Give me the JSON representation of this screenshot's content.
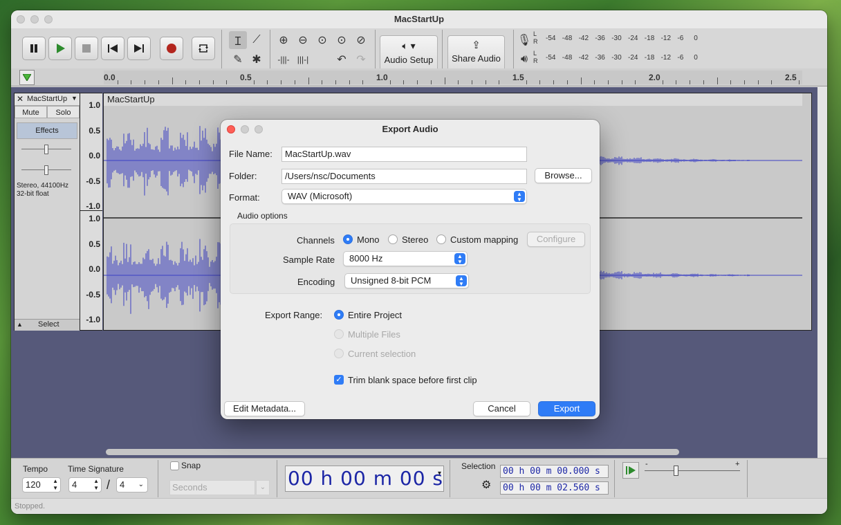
{
  "window": {
    "title": "MacStartUp"
  },
  "toolbar": {
    "audio_setup_label": "Audio Setup",
    "share_audio_label": "Share Audio",
    "meter_scale": [
      "-54",
      "-48",
      "-42",
      "-36",
      "-30",
      "-24",
      "-18",
      "-12",
      "-6",
      "0"
    ],
    "meter_channels": [
      "L",
      "R"
    ]
  },
  "ruler": {
    "ticks": [
      "0.0",
      "0.5",
      "1.0",
      "1.5",
      "2.0",
      "2.5"
    ]
  },
  "track": {
    "name": "MacStartUp",
    "clip_name": "MacStartUp",
    "mute_label": "Mute",
    "solo_label": "Solo",
    "effects_label": "Effects",
    "info_line1": "Stereo, 44100Hz",
    "info_line2": "32-bit float",
    "select_label": "Select",
    "scale_labels": [
      "1.0",
      "0.5",
      "0.0",
      "-0.5",
      "-1.0"
    ]
  },
  "dialog": {
    "title": "Export Audio",
    "file_name_label": "File Name:",
    "file_name_value": "MacStartUp.wav",
    "folder_label": "Folder:",
    "folder_value": "/Users/nsc/Documents",
    "browse_label": "Browse...",
    "format_label": "Format:",
    "format_value": "WAV (Microsoft)",
    "audio_options_label": "Audio options",
    "channels_label": "Channels",
    "channel_options": [
      "Mono",
      "Stereo",
      "Custom mapping"
    ],
    "channel_selected": "Mono",
    "configure_label": "Configure",
    "sample_rate_label": "Sample Rate",
    "sample_rate_value": "8000 Hz",
    "encoding_label": "Encoding",
    "encoding_value": "Unsigned 8-bit PCM",
    "export_range_label": "Export Range:",
    "range_options": [
      "Entire Project",
      "Multiple Files",
      "Current selection"
    ],
    "range_selected": "Entire Project",
    "trim_label": "Trim blank space before first clip",
    "trim_checked": true,
    "edit_metadata_label": "Edit Metadata...",
    "cancel_label": "Cancel",
    "export_label": "Export"
  },
  "bottom": {
    "tempo_label": "Tempo",
    "tempo_value": "120",
    "time_sig_label": "Time Signature",
    "time_sig_num": "4",
    "time_sig_slash": "/",
    "time_sig_den": "4",
    "snap_label": "Snap",
    "snap_unit": "Seconds",
    "time_display": "00 h 00 m 00 s",
    "selection_label": "Selection",
    "selection_start": "00 h 00 m 00.000 s",
    "selection_end": "00 h 00 m 02.560 s",
    "slider_minus": "-",
    "slider_plus": "+"
  },
  "status": {
    "text": "Stopped."
  },
  "colors": {
    "accent": "#2f7cf6",
    "waveform": "#3b3fc4",
    "track_bg": "#56597a",
    "record": "#b3261e",
    "time_digits": "#1d27a6"
  }
}
